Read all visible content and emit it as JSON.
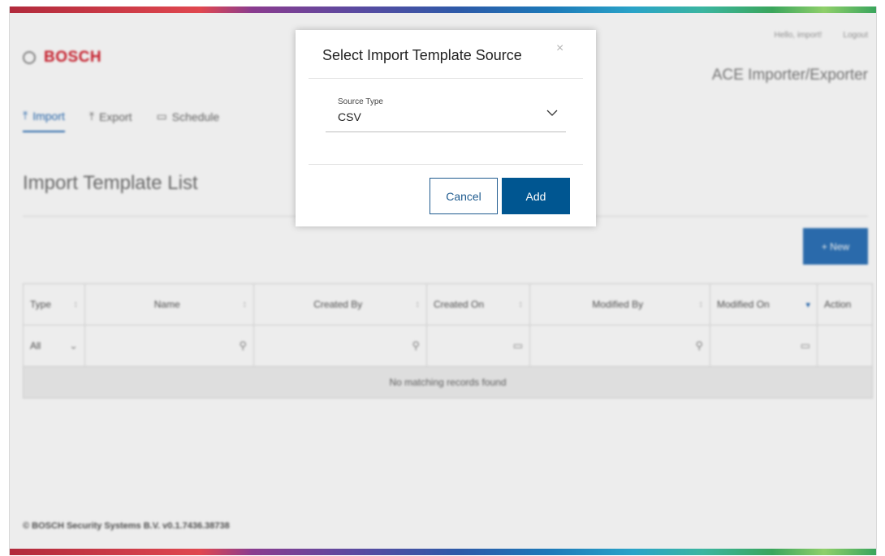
{
  "header": {
    "brand_name": "BOSCH",
    "greeting": "Hello, import!",
    "logout_label": "Logout",
    "app_title": "ACE Importer/Exporter"
  },
  "tabs": [
    {
      "label": "Import",
      "icon": "upload-icon",
      "active": true
    },
    {
      "label": "Export",
      "icon": "export-icon",
      "active": false
    },
    {
      "label": "Schedule",
      "icon": "calendar-icon",
      "active": false
    }
  ],
  "page": {
    "title": "Import Template List",
    "new_button_label": "+ New"
  },
  "table": {
    "columns": [
      "Type",
      "Name",
      "Created By",
      "Created On",
      "Modified By",
      "Modified On",
      "Action"
    ],
    "type_filter_value": "All",
    "empty_message": "No matching records found"
  },
  "footer": {
    "text": "© BOSCH Security Systems B.V. v0.1.7436.38738"
  },
  "modal": {
    "title": "Select Import Template Source",
    "close_glyph": "×",
    "source_type_label": "Source Type",
    "source_type_value": "CSV",
    "cancel_label": "Cancel",
    "add_label": "Add"
  },
  "colors": {
    "brand_red": "#d4212f",
    "primary_blue": "#005691",
    "accent_blue": "#2a6db5"
  }
}
